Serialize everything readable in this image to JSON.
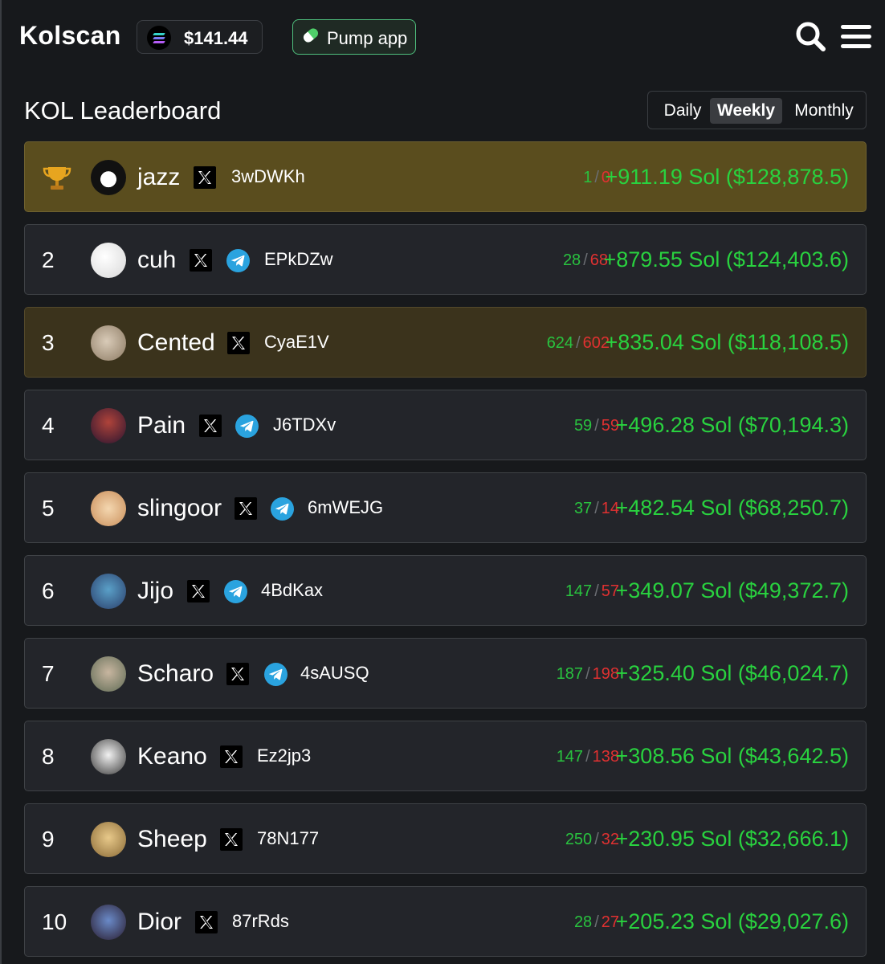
{
  "header": {
    "brand": "Kolscan",
    "sol_price": "$141.44",
    "sol_icon": "solana-logo-icon",
    "pump_label": "Pump app",
    "pump_icon": "pill-icon",
    "search_icon": "search-icon",
    "menu_icon": "hamburger-menu-icon"
  },
  "page": {
    "title": "KOL Leaderboard",
    "tabs": [
      {
        "label": "Daily",
        "active": false
      },
      {
        "label": "Weekly",
        "active": true
      },
      {
        "label": "Monthly",
        "active": false
      }
    ]
  },
  "colors": {
    "win": "#29c23f",
    "loss": "#e03131",
    "pnl": "#29d23f",
    "gold_row": "#5a4d1e",
    "bronze_row": "#3b331c",
    "row": "#23252a",
    "telegram": "#2aa3df"
  },
  "leaderboard": [
    {
      "rank": "1",
      "name": "jazz",
      "has_telegram": false,
      "wallet": "3wDWKh",
      "wins": "1",
      "losses": "0",
      "pnl": "+911.19 Sol ($128,878.5)",
      "highlight": "gold",
      "rank_icon": "trophy-icon"
    },
    {
      "rank": "2",
      "name": "cuh",
      "has_telegram": true,
      "wallet": "EPkDZw",
      "wins": "28",
      "losses": "68",
      "pnl": "+879.55 Sol ($124,403.6)",
      "highlight": "none"
    },
    {
      "rank": "3",
      "name": "Cented",
      "has_telegram": false,
      "wallet": "CyaE1V",
      "wins": "624",
      "losses": "602",
      "pnl": "+835.04 Sol ($118,108.5)",
      "highlight": "bronze"
    },
    {
      "rank": "4",
      "name": "Pain",
      "has_telegram": true,
      "wallet": "J6TDXv",
      "wins": "59",
      "losses": "59",
      "pnl": "+496.28 Sol ($70,194.3)",
      "highlight": "none"
    },
    {
      "rank": "5",
      "name": "slingoor",
      "has_telegram": true,
      "wallet": "6mWEJG",
      "wins": "37",
      "losses": "14",
      "pnl": "+482.54 Sol ($68,250.7)",
      "highlight": "none"
    },
    {
      "rank": "6",
      "name": "Jijo",
      "has_telegram": true,
      "wallet": "4BdKax",
      "wins": "147",
      "losses": "57",
      "pnl": "+349.07 Sol ($49,372.7)",
      "highlight": "none"
    },
    {
      "rank": "7",
      "name": "Scharo",
      "has_telegram": true,
      "wallet": "4sAUSQ",
      "wins": "187",
      "losses": "198",
      "pnl": "+325.40 Sol ($46,024.7)",
      "highlight": "none"
    },
    {
      "rank": "8",
      "name": "Keano",
      "has_telegram": false,
      "wallet": "Ez2jp3",
      "wins": "147",
      "losses": "138",
      "pnl": "+308.56 Sol ($43,642.5)",
      "highlight": "none"
    },
    {
      "rank": "9",
      "name": "Sheep",
      "has_telegram": false,
      "wallet": "78N177",
      "wins": "250",
      "losses": "32",
      "pnl": "+230.95 Sol ($32,666.1)",
      "highlight": "none"
    },
    {
      "rank": "10",
      "name": "Dior",
      "has_telegram": false,
      "wallet": "87rRds",
      "wins": "28",
      "losses": "27",
      "pnl": "+205.23 Sol ($29,027.6)",
      "highlight": "none"
    }
  ]
}
